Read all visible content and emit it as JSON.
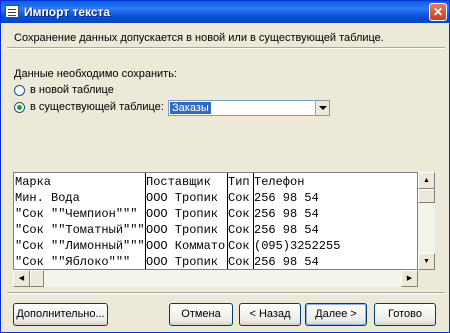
{
  "window": {
    "title": "Импорт текста",
    "close_glyph": "✕"
  },
  "description": "Сохранение данных допускается в новой или в существующей таблице.",
  "save_section": {
    "label": "Данные необходимо сохранить:",
    "options": [
      {
        "label": "в новой таблице",
        "checked": false
      },
      {
        "label": "в существующей таблице:",
        "checked": true
      }
    ],
    "table_select_value": "Заказы"
  },
  "preview": {
    "rows": [
      [
        "Марка",
        "Поставщик",
        "Тип",
        "Телефон"
      ],
      [
        "Мин. Вода",
        "ООО Тропик",
        "Сок",
        "256 98 54"
      ],
      [
        "\"Сок \"\"Чемпион\"\"\"",
        "ООО Тропик",
        "Сок",
        "256 98 54"
      ],
      [
        "\"Сок \"\"Томатный\"\"\"",
        "ООО Тропик",
        "Сок",
        "256 98 54"
      ],
      [
        "\"Сок \"\"Лимонный\"\"\"",
        "ООО Коммато",
        "Сок",
        "(095)3252255"
      ],
      [
        "\"Сок \"\"Яблоко\"\"\"",
        "ООО Тропик",
        "Сок",
        "256 98 54"
      ]
    ]
  },
  "buttons": {
    "advanced": "Дополнительно...",
    "cancel": "Отмена",
    "back": "< Назад",
    "next": "Далее >",
    "finish": "Готово"
  },
  "icons": {
    "title": "table-icon",
    "up": "arrow-up-icon",
    "down": "arrow-down-icon",
    "left": "arrow-left-icon",
    "right": "arrow-right-icon"
  }
}
